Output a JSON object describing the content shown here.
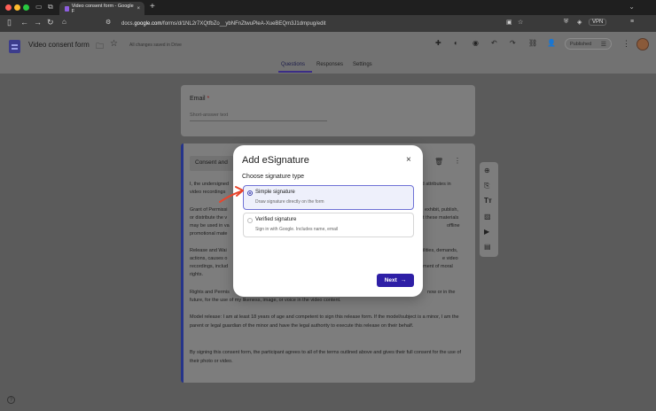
{
  "browser": {
    "tab_title": "Video consent form - Google F",
    "tab_close": "×",
    "new_tab": "+",
    "url_prefix": "docs.",
    "url_domain": "google.com",
    "url_path": "/forms/d/1NL2r7XQtfbZo__ybNFnZtwuPleA-XueBEQm3J1dmpug/edit",
    "vpn_label": "VPN"
  },
  "header": {
    "form_title": "Video consent form",
    "saved_status": "All changes saved in Drive",
    "published_label": "Published"
  },
  "tabs": {
    "questions": "Questions",
    "responses": "Responses",
    "settings": "Settings"
  },
  "email_card": {
    "label": "Email",
    "required_mark": "*",
    "placeholder": "Short-answer text"
  },
  "consent_card": {
    "title_partial": "Consent and",
    "p1_line1": "I, the undersigned",
    "p1_line1_right": "ated attributes in",
    "p1_line2": "video recordings",
    "p2_line1": "Grant of Permissi",
    "p2_line1_right": "exhibit, publish,",
    "p2_line2": "or distribute the v",
    "p2_line2_right": "t these materials",
    "p2_line3": "may be used in va",
    "p2_line3_right": "offline",
    "p2_line4": "promotional mate",
    "p3_line1": "Release and Wai",
    "p3_line1_right": "ilities, demands,",
    "p3_line2": "actions, causes o",
    "p3_line2_right": "e video",
    "p3_line3": "recordings, includ",
    "p3_line3_right": "gement of moral",
    "p3_line4": "rights.",
    "p4_line1": "Rights and Permis",
    "p4_line1_right": "now or in the",
    "p4_line2": "future, for the use of my likeness, image, or voice in the video content.",
    "p5": "Model release: I am at least 18 years of age and competent to sign this release form. If the model/subject is a minor, I am the parent or legal guardian of the minor and have the legal authority to execute this release on their behalf.",
    "p6": "By signing this consent form, the participant agrees to all of the terms outlined above and gives their full consent for the use of their photo or video."
  },
  "modal": {
    "title": "Add eSignature",
    "close": "×",
    "choose_label": "Choose signature type",
    "options": [
      {
        "title": "Simple signature",
        "subtitle": "Draw signature directly on the form",
        "selected": true
      },
      {
        "title": "Verified signature",
        "subtitle": "Sign in with Google. Includes name, email",
        "selected": false
      }
    ],
    "next_label": "Next",
    "next_arrow": "→"
  },
  "help": "?",
  "colors": {
    "accent": "#2e1fa6",
    "annotation_arrow": "#e8452c",
    "selected_option_bg": "#eef0fb"
  }
}
